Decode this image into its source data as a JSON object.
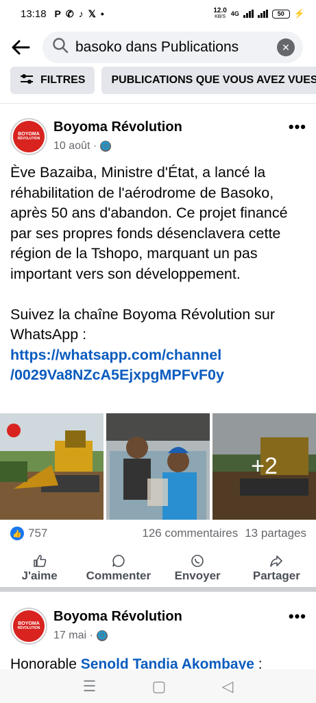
{
  "status_bar": {
    "time": "13:18",
    "notif_icons": [
      "P",
      "whatsapp-icon",
      "tiktok-icon",
      "X",
      "•"
    ],
    "net_speed": "12.0",
    "net_unit": "KB/S",
    "network": "4G",
    "battery": "50"
  },
  "search": {
    "value": "basoko dans Publications"
  },
  "chips": {
    "filters_label": "FILTRES",
    "seen_label": "PUBLICATIONS QUE VOUS AVEZ VUES"
  },
  "post1": {
    "page_name": "Boyoma Révolution",
    "date": "10 août ·",
    "paragraph1": "Ève Bazaiba, Ministre d'État, a lancé la réhabilitation de l'aérodrome de Basoko, après 50 ans d'abandon. Ce projet financé par ses propres fonds désenclavera cette région de la Tshopo, marquant un pas important vers son développement.",
    "paragraph2": "Suivez la chaîne Boyoma Révolution sur WhatsApp  :",
    "link_line1": "https://whatsapp.com/channel",
    "link_line2": "/0029Va8NZcA5EjxpgMPFvF0y",
    "more_photos": "+2",
    "likes": "757",
    "comments": "126 commentaires",
    "shares": "13 partages"
  },
  "actions": {
    "like": "J'aime",
    "comment": "Commenter",
    "send": "Envoyer",
    "share": "Partager"
  },
  "post2": {
    "page_name": "Boyoma Révolution",
    "date": "17 mai ·",
    "preview_text": "Honorable ",
    "preview_link": "Senold Tandia Akombaye",
    "preview_tail": " :"
  },
  "avatar_text": {
    "line1": "BOYOMA",
    "line2": "RÉVOLUTION"
  },
  "colors": {
    "accent_blue": "#1877f2",
    "link_blue": "#0a5bbf",
    "avatar_red": "#d8231f"
  }
}
